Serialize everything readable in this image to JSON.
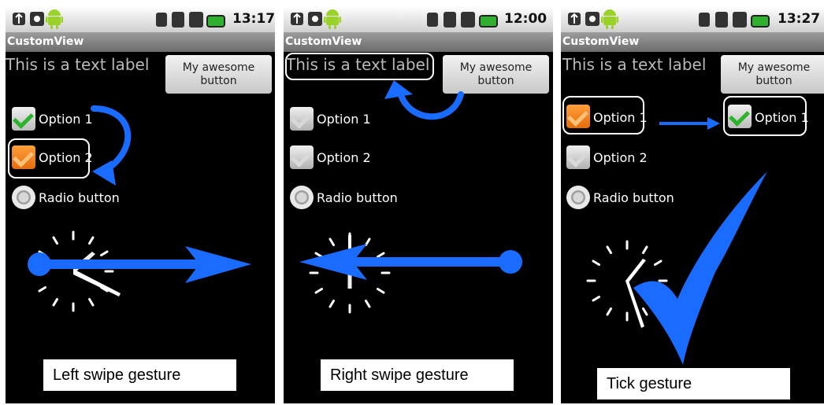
{
  "screens": [
    {
      "time": "13:17",
      "app_title": "CustomView",
      "text_label": "This is a text label",
      "button_label_line1": "My awesome",
      "button_label_line2": "button",
      "option1": "Option 1",
      "option2": "Option 2",
      "radio": "Radio button",
      "caption": "Left swipe gesture"
    },
    {
      "time": "12:00",
      "app_title": "CustomView",
      "text_label": "This is a text label",
      "button_label_line1": "My awesome",
      "button_label_line2": "button",
      "option1": "Option 1",
      "option2": "Option 2",
      "radio": "Radio button",
      "caption": "Right swipe gesture"
    },
    {
      "time": "13:27",
      "app_title": "CustomView",
      "text_label": "This is a text label",
      "button_label_line1": "My awesome",
      "button_label_line2": "button",
      "option1": "Option 1",
      "option2": "Option 2",
      "radio": "Radio button",
      "caption": "Tick gesture",
      "option1_copy": "Option 1"
    }
  ],
  "colors": {
    "gesture_blue": "#1a6bff",
    "check_green": "#2bb32b",
    "check_orange": "#f07a14"
  }
}
